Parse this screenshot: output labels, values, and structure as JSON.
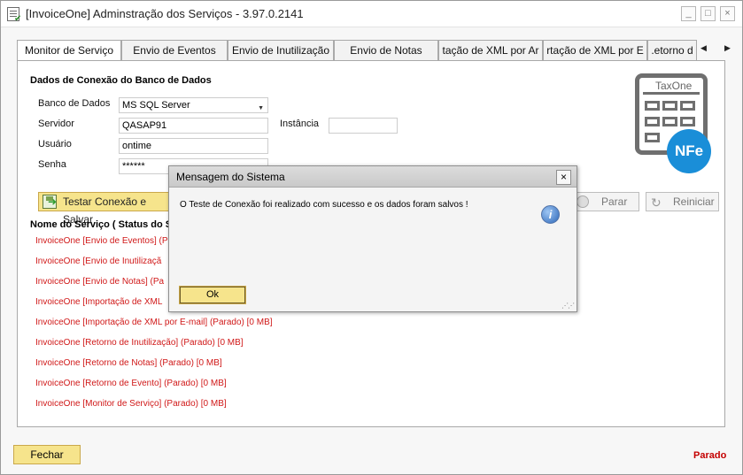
{
  "window": {
    "title": "[InvoiceOne] Adminstração dos Serviços - 3.97.0.2141",
    "minimize": "_",
    "maximize": "□",
    "close": "×"
  },
  "tabs": [
    {
      "label": "Monitor de Serviço",
      "active": true
    },
    {
      "label": "Envio de Eventos"
    },
    {
      "label": "Envio de Inutilização"
    },
    {
      "label": "Envio de Notas"
    },
    {
      "label": "tação de XML por Ar"
    },
    {
      "label": "rtação de XML por E"
    },
    {
      "label": ".etorno d"
    }
  ],
  "tab_scroll": {
    "left": "◀",
    "right": "▶"
  },
  "connection": {
    "section_title": "Dados de Conexão do Banco de Dados",
    "db_label": "Banco de Dados",
    "db_value": "MS SQL Server",
    "server_label": "Servidor",
    "server_value": "QASAP91",
    "instance_label": "Instância",
    "instance_value": "",
    "user_label": "Usuário",
    "user_value": "ontime",
    "password_label": "Senha",
    "password_value": "******"
  },
  "buttons": {
    "test_save": "Testar Conexão e Salvar",
    "stop": "Parar",
    "restart": "Reiniciar",
    "close": "Fechar"
  },
  "services": {
    "header": "Nome do Serviço ( Status do S",
    "items": [
      "InvoiceOne [Envio de Eventos] (P",
      "InvoiceOne [Envio de Inutilizaçã",
      "InvoiceOne [Envio de Notas] (Pa",
      "InvoiceOne [Importação de XML",
      "InvoiceOne [Importação de XML por E-mail] (Parado) [0 MB]",
      "InvoiceOne [Retorno de Inutilização] (Parado) [0 MB]",
      "InvoiceOne [Retorno de Notas] (Parado) [0 MB]",
      "InvoiceOne [Retorno de Evento] (Parado) [0 MB]",
      "InvoiceOne [Monitor de Serviço] (Parado) [0 MB]"
    ]
  },
  "logo": {
    "brand": "TaxOne",
    "badge": "NFe"
  },
  "status": "Parado",
  "dialog": {
    "title": "Mensagem do Sistema",
    "message": "O Teste de Conexão foi realizado com sucesso e os dados foram salvos !",
    "ok": "Ok",
    "close": "×",
    "info_glyph": "i"
  },
  "colors": {
    "error_red": "#d01818",
    "accent_yellow": "#f6e48c",
    "nfe_blue": "#1a8ed8"
  }
}
